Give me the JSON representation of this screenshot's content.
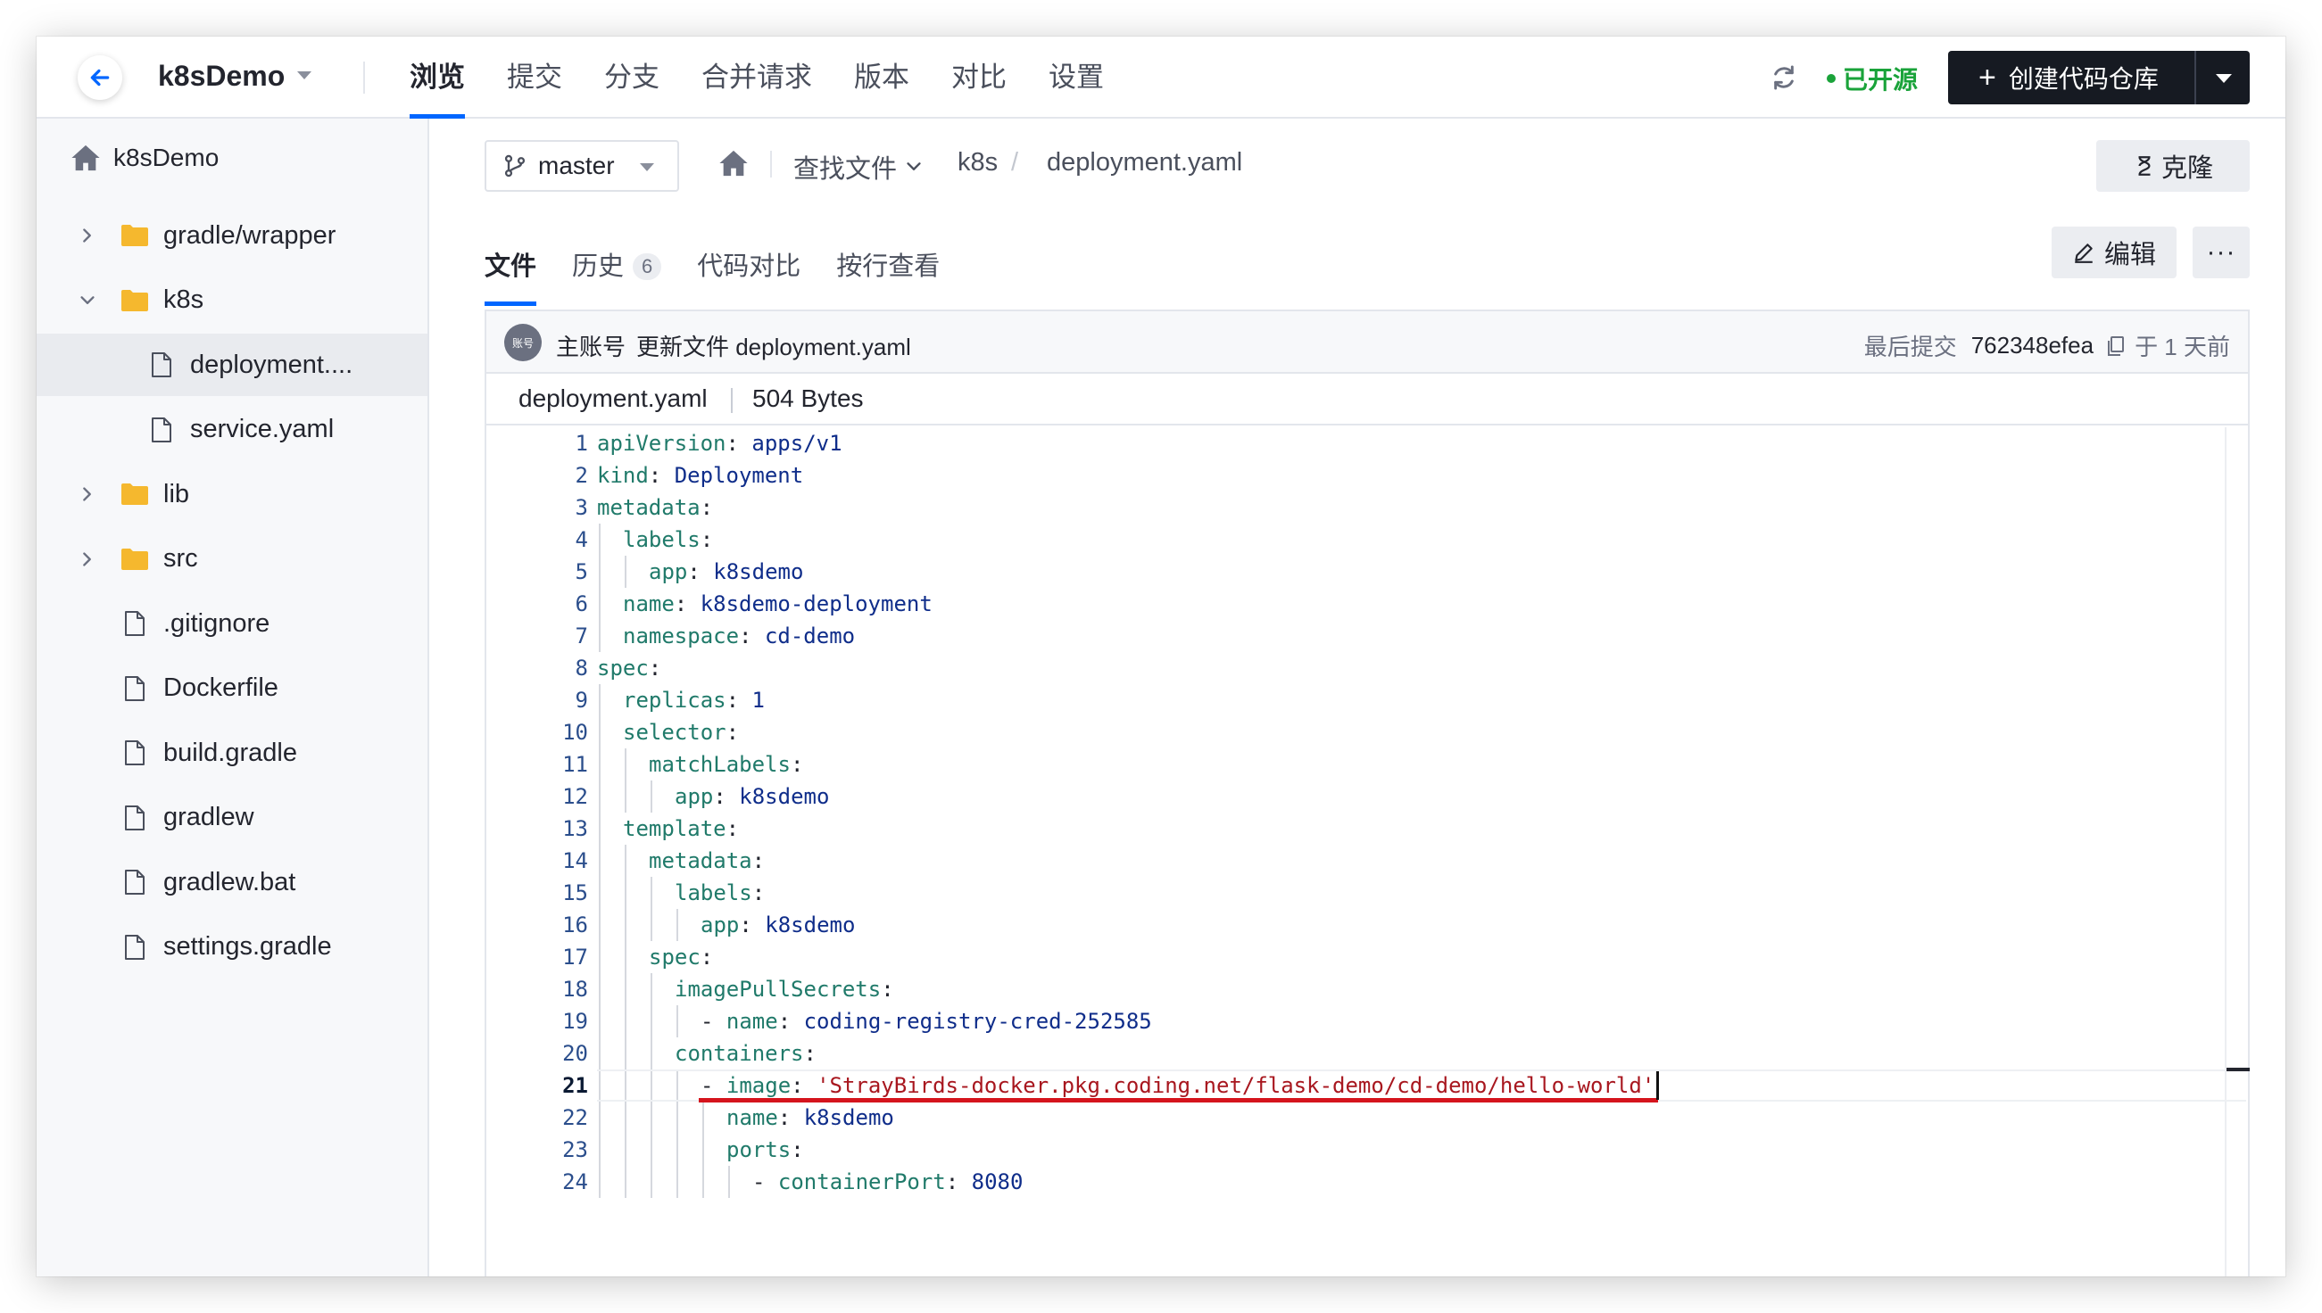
{
  "topbar": {
    "repo_name": "k8sDemo",
    "nav": [
      "浏览",
      "提交",
      "分支",
      "合并请求",
      "版本",
      "对比",
      "设置"
    ],
    "active_nav": 0,
    "status": "已开源",
    "create_label": "创建代码仓库"
  },
  "sidebar": {
    "root": "k8sDemo",
    "items": [
      {
        "label": "gradle/wrapper",
        "type": "folder",
        "depth": 0,
        "expanded": false
      },
      {
        "label": "k8s",
        "type": "folder",
        "depth": 0,
        "expanded": true
      },
      {
        "label": "deployment....",
        "type": "file",
        "depth": 1,
        "selected": true
      },
      {
        "label": "service.yaml",
        "type": "file",
        "depth": 1
      },
      {
        "label": "lib",
        "type": "folder",
        "depth": 0,
        "expanded": false
      },
      {
        "label": "src",
        "type": "folder",
        "depth": 0,
        "expanded": false
      },
      {
        "label": ".gitignore",
        "type": "file",
        "depth": 0
      },
      {
        "label": "Dockerfile",
        "type": "file",
        "depth": 0
      },
      {
        "label": "build.gradle",
        "type": "file",
        "depth": 0
      },
      {
        "label": "gradlew",
        "type": "file",
        "depth": 0
      },
      {
        "label": "gradlew.bat",
        "type": "file",
        "depth": 0
      },
      {
        "label": "settings.gradle",
        "type": "file",
        "depth": 0
      }
    ]
  },
  "toolbar": {
    "branch": "master",
    "find_files": "查找文件",
    "crumb_dir": "k8s",
    "crumb_file": "deployment.yaml",
    "clone_label": "克隆",
    "edit_label": "编辑",
    "more_label": "···"
  },
  "tabs": [
    {
      "label": "文件",
      "active": true
    },
    {
      "label": "历史",
      "badge": "6"
    },
    {
      "label": "代码对比"
    },
    {
      "label": "按行查看"
    }
  ],
  "commit": {
    "avatar_text": "账号",
    "author": "主账号",
    "message": "更新文件 deployment.yaml",
    "last_commit_label": "最后提交",
    "hash": "762348efea",
    "time": "于 1 天前"
  },
  "file_info": {
    "name": "deployment.yaml",
    "size": "504 Bytes"
  },
  "code": {
    "current_line": 21,
    "lines": [
      {
        "indent": 0,
        "key": "apiVersion",
        "value": "apps/v1"
      },
      {
        "indent": 0,
        "key": "kind",
        "value": "Deployment"
      },
      {
        "indent": 0,
        "key": "metadata",
        "value": ""
      },
      {
        "indent": 1,
        "key": "labels",
        "value": ""
      },
      {
        "indent": 2,
        "key": "app",
        "value": "k8sdemo"
      },
      {
        "indent": 1,
        "key": "name",
        "value": "k8sdemo-deployment"
      },
      {
        "indent": 1,
        "key": "namespace",
        "value": "cd-demo"
      },
      {
        "indent": 0,
        "key": "spec",
        "value": ""
      },
      {
        "indent": 1,
        "key": "replicas",
        "value": "1"
      },
      {
        "indent": 1,
        "key": "selector",
        "value": ""
      },
      {
        "indent": 2,
        "key": "matchLabels",
        "value": ""
      },
      {
        "indent": 3,
        "key": "app",
        "value": "k8sdemo"
      },
      {
        "indent": 1,
        "key": "template",
        "value": ""
      },
      {
        "indent": 2,
        "key": "metadata",
        "value": ""
      },
      {
        "indent": 3,
        "key": "labels",
        "value": ""
      },
      {
        "indent": 4,
        "key": "app",
        "value": "k8sdemo"
      },
      {
        "indent": 2,
        "key": "spec",
        "value": ""
      },
      {
        "indent": 3,
        "key": "imagePullSecrets",
        "value": ""
      },
      {
        "indent": 4,
        "dash": true,
        "key": "name",
        "value": "coding-registry-cred-252585"
      },
      {
        "indent": 3,
        "key": "containers",
        "value": ""
      },
      {
        "indent": 4,
        "dash": true,
        "key": "image",
        "value": "'StrayBirds-docker.pkg.coding.net/flask-demo/cd-demo/hello-world'",
        "string": true,
        "highlight": true
      },
      {
        "indent": 5,
        "key": "name",
        "value": "k8sdemo"
      },
      {
        "indent": 5,
        "key": "ports",
        "value": ""
      },
      {
        "indent": 6,
        "dash": true,
        "key": "containerPort",
        "value": "8080"
      }
    ]
  },
  "colors": {
    "accent": "#0066ff",
    "open_source": "#1aa33a",
    "highlight_underline": "#d5141d",
    "create_button": "#161a22"
  }
}
